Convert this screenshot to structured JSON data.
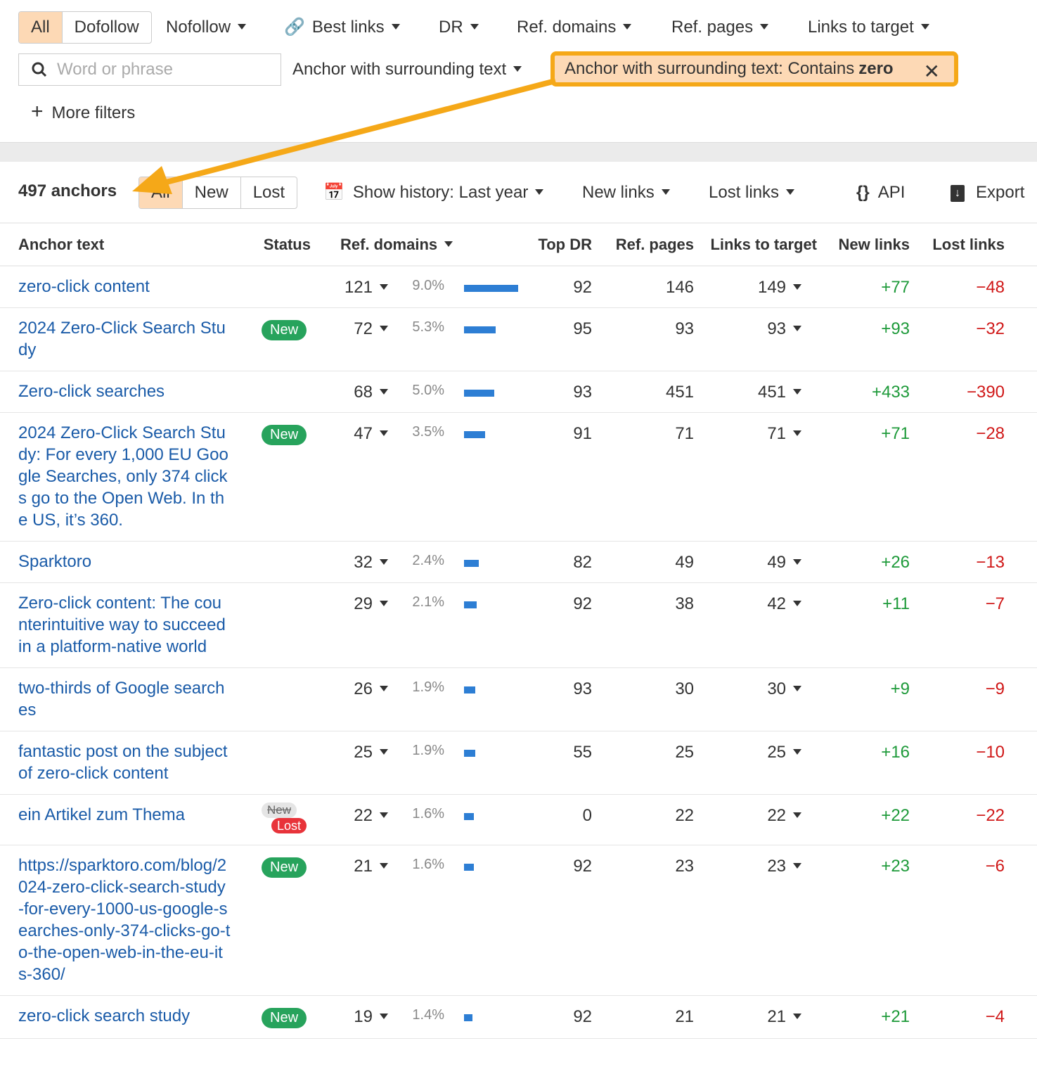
{
  "filters": {
    "follow_segments": [
      "All",
      "Dofollow"
    ],
    "nofollow": "Nofollow",
    "best_links": "Best links",
    "dr": "DR",
    "ref_domains": "Ref. domains",
    "ref_pages": "Ref. pages",
    "links_to_target": "Links to target",
    "search_placeholder": "Word or phrase",
    "anchor_mode": "Anchor with surrounding text",
    "active_chip_prefix": "Anchor with surrounding text: Contains",
    "active_chip_value": "zero",
    "more_filters": "More filters"
  },
  "toolbar": {
    "count": "497 anchors",
    "tabs": [
      "All",
      "New",
      "Lost"
    ],
    "history": "Show history: Last year",
    "new_links": "New links",
    "lost_links": "Lost links",
    "api": "API",
    "export": "Export"
  },
  "table": {
    "headers": [
      "Anchor text",
      "Status",
      "Ref. domains",
      "Top DR",
      "Ref. pages",
      "Links to target",
      "New links",
      "Lost links"
    ],
    "rows": [
      {
        "anchor": "zero-click content",
        "status": "",
        "ref_domains": "121",
        "pct": "9.0%",
        "share": 9.0,
        "top_dr": "92",
        "ref_pages": "146",
        "links": "149",
        "new": "+77",
        "lost": "−48"
      },
      {
        "anchor": "2024 Zero-Click Search Study",
        "status": "New",
        "ref_domains": "72",
        "pct": "5.3%",
        "share": 5.3,
        "top_dr": "95",
        "ref_pages": "93",
        "links": "93",
        "new": "+93",
        "lost": "−32"
      },
      {
        "anchor": "Zero-click searches",
        "status": "",
        "ref_domains": "68",
        "pct": "5.0%",
        "share": 5.0,
        "top_dr": "93",
        "ref_pages": "451",
        "links": "451",
        "new": "+433",
        "lost": "−390"
      },
      {
        "anchor": "2024 Zero-Click Search Study: For every 1,000 EU Google Searches, only 374 clicks go to the Open Web. In the US, it’s 360.",
        "status": "New",
        "ref_domains": "47",
        "pct": "3.5%",
        "share": 3.5,
        "top_dr": "91",
        "ref_pages": "71",
        "links": "71",
        "new": "+71",
        "lost": "−28"
      },
      {
        "anchor": "Sparktoro",
        "status": "",
        "ref_domains": "32",
        "pct": "2.4%",
        "share": 2.4,
        "top_dr": "82",
        "ref_pages": "49",
        "links": "49",
        "new": "+26",
        "lost": "−13"
      },
      {
        "anchor": "Zero-click content: The counterintuitive way to succeed in a platform-native world",
        "status": "",
        "ref_domains": "29",
        "pct": "2.1%",
        "share": 2.1,
        "top_dr": "92",
        "ref_pages": "38",
        "links": "42",
        "new": "+11",
        "lost": "−7"
      },
      {
        "anchor": "two-thirds of Google searches",
        "status": "",
        "ref_domains": "26",
        "pct": "1.9%",
        "share": 1.9,
        "top_dr": "93",
        "ref_pages": "30",
        "links": "30",
        "new": "+9",
        "lost": "−9"
      },
      {
        "anchor": "fantastic post on the subject of zero-click content",
        "status": "",
        "ref_domains": "25",
        "pct": "1.9%",
        "share": 1.9,
        "top_dr": "55",
        "ref_pages": "25",
        "links": "25",
        "new": "+16",
        "lost": "−10"
      },
      {
        "anchor": "ein Artikel zum Thema",
        "status": "New|Lost",
        "ref_domains": "22",
        "pct": "1.6%",
        "share": 1.6,
        "top_dr": "0",
        "ref_pages": "22",
        "links": "22",
        "new": "+22",
        "lost": "−22"
      },
      {
        "anchor": "https://sparktoro.com/blog/2024-zero-click-search-study-for-every-1000-us-google-searches-only-374-clicks-go-to-the-open-web-in-the-eu-its-360/",
        "status": "New",
        "ref_domains": "21",
        "pct": "1.6%",
        "share": 1.6,
        "top_dr": "92",
        "ref_pages": "23",
        "links": "23",
        "new": "+23",
        "lost": "−6"
      },
      {
        "anchor": "zero-click search study",
        "status": "New",
        "ref_domains": "19",
        "pct": "1.4%",
        "share": 1.4,
        "top_dr": "92",
        "ref_pages": "21",
        "links": "21",
        "new": "+21",
        "lost": "−4"
      }
    ]
  }
}
